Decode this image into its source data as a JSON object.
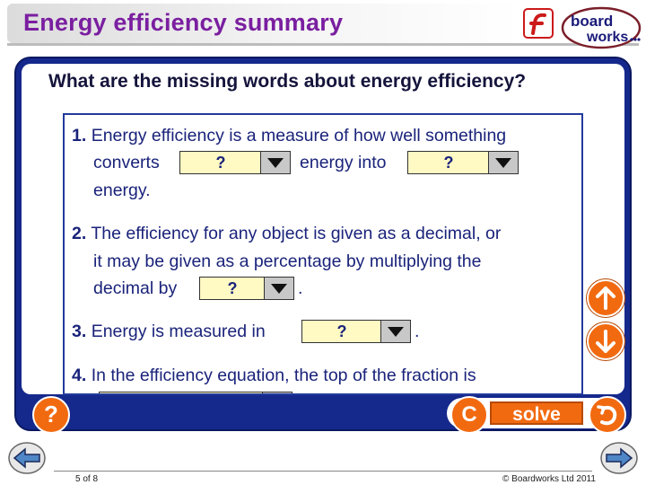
{
  "header": {
    "title": "Energy efficiency summary",
    "logo_text_top": "board",
    "logo_text_bottom": "works"
  },
  "main": {
    "question": "What are the missing words about energy efficiency?",
    "items": [
      {
        "number": "1.",
        "line1": "Energy efficiency is a measure of how well something",
        "line2_a": "converts",
        "line2_b": "energy into",
        "line3": "energy."
      },
      {
        "number": "2.",
        "line1": "The efficiency for any object is given as a decimal, or",
        "line2": "it may be given as a percentage by multiplying the",
        "line3_a": "decimal by",
        "line3_b": "."
      },
      {
        "number": "3.",
        "line1_a": "Energy is measured in",
        "line1_b": "."
      },
      {
        "number": "4.",
        "line1": "In the efficiency equation, the top of the fraction is"
      }
    ],
    "dropdown_value": "?",
    "help_label": "?",
    "reset_label": "C",
    "solve_label": "solve"
  },
  "footer": {
    "page": "5 of 8",
    "copyright": "© Boardworks Ltd 2011"
  },
  "colors": {
    "title": "#7a1fa0",
    "panel": "#15288c",
    "accent_orange": "#f26a10",
    "dropdown_bg": "#fff9c4",
    "text": "#1a237a"
  }
}
